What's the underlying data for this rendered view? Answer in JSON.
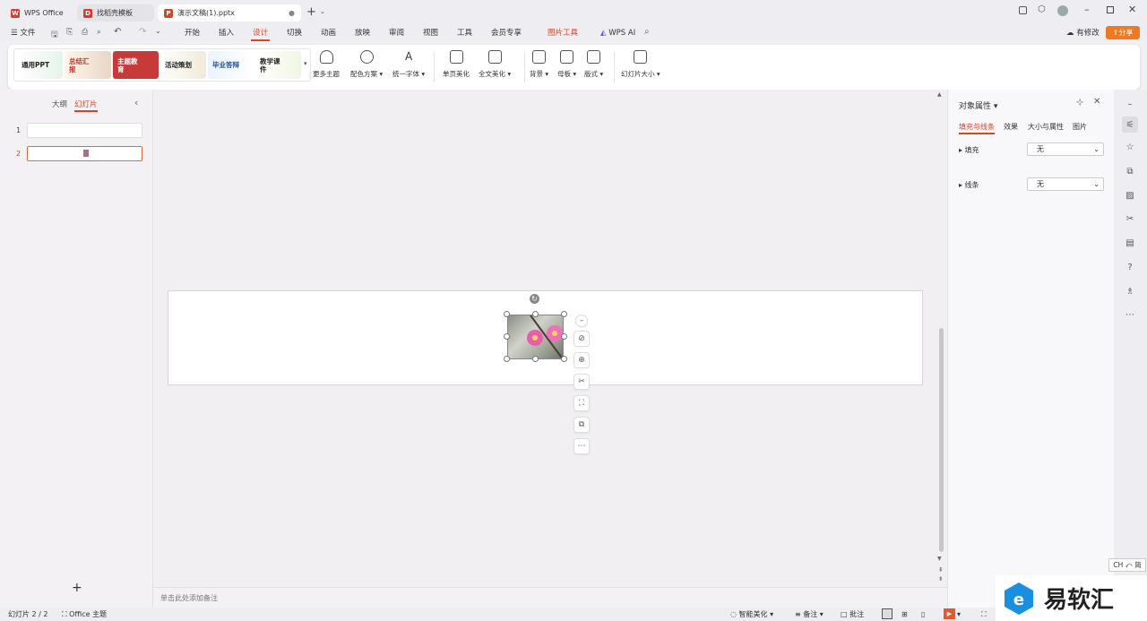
{
  "tabs": [
    {
      "label": "WPS Office"
    },
    {
      "label": "找稻壳模板"
    },
    {
      "label": "演示文稿(1).pptx"
    }
  ],
  "menu": {
    "file": "文件",
    "items": [
      "开始",
      "插入",
      "设计",
      "切换",
      "动画",
      "放映",
      "审阅",
      "视图",
      "工具",
      "会员专享"
    ],
    "picture_tools": "图片工具",
    "wps_ai": "WPS AI",
    "has_changes": "有修改",
    "share": "分享"
  },
  "ribbon": {
    "templates": [
      {
        "label": "通用PPT"
      },
      {
        "label": "总结汇报"
      },
      {
        "label": "主题教育"
      },
      {
        "label": "活动策划"
      },
      {
        "label": "毕业答辩"
      },
      {
        "label": "教学课件"
      }
    ],
    "buttons": {
      "more_themes": "更多主题",
      "color_scheme": "配色方案",
      "unify_font": "统一字体",
      "single_beautify": "单页美化",
      "full_beautify": "全文美化",
      "background": "背景",
      "master": "母板",
      "layout": "版式",
      "slide_size": "幻灯片大小"
    }
  },
  "left_panel": {
    "outline_tab": "大纲",
    "slides_tab": "幻灯片",
    "slides": [
      {
        "number": "1"
      },
      {
        "number": "2"
      }
    ],
    "add": "+"
  },
  "notes_placeholder": "单击此处添加备注",
  "right_panel": {
    "title": "对象属性",
    "tabs": [
      "填充与线条",
      "效果",
      "大小与属性",
      "图片"
    ],
    "fill_label": "填充",
    "fill_value": "无",
    "line_label": "线条",
    "line_value": "无"
  },
  "status": {
    "slide_count": "幻灯片 2 / 2",
    "theme": "Office 主题",
    "smart_beautify": "智能美化",
    "notes": "备注",
    "comments": "批注"
  },
  "ime": "CH ⤺ 简",
  "watermark": "易软汇",
  "colors": {
    "accent": "#d24726",
    "brand_wps": "#e0362b",
    "share_btn": "#f0781e"
  }
}
